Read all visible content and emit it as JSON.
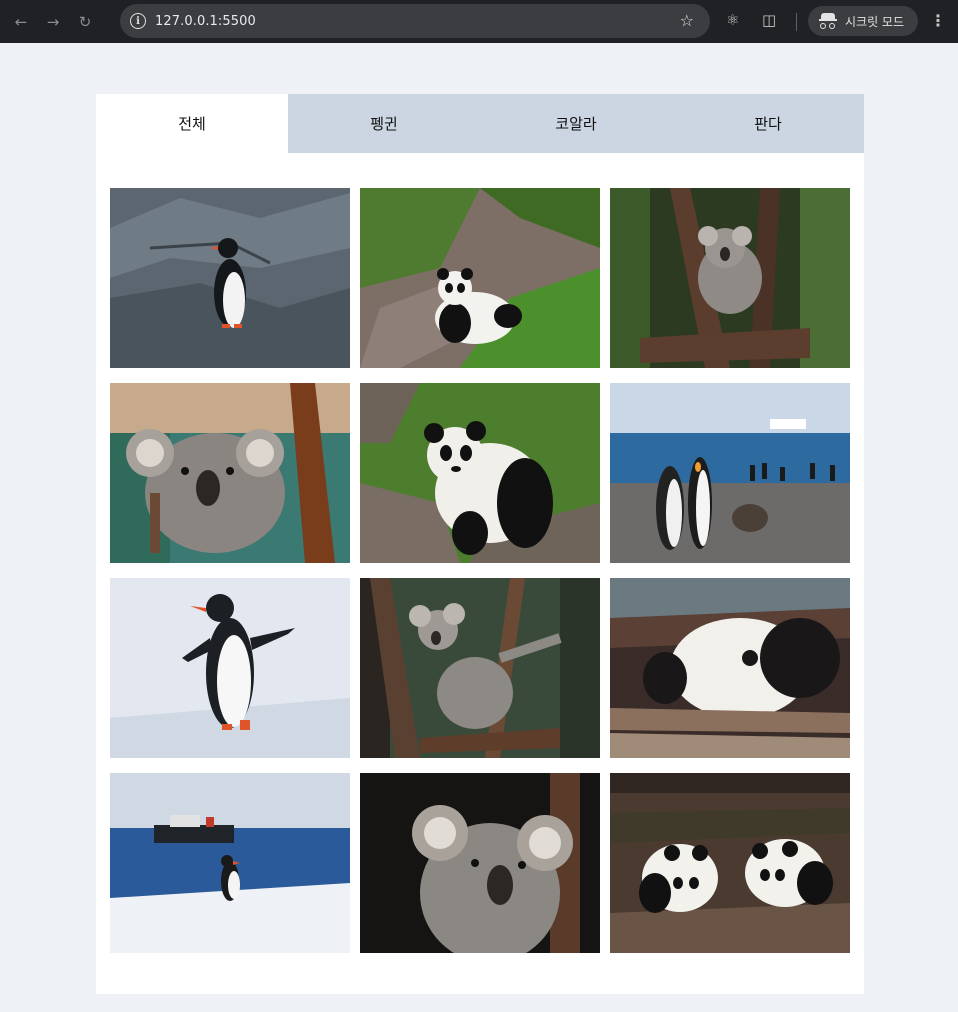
{
  "browser": {
    "url": "127.0.0.1:5500",
    "incognito_label": "시크릿 모드",
    "icons": [
      "back-arrow-icon",
      "forward-arrow-icon",
      "reload-icon",
      "info-icon",
      "star-icon",
      "react-icon",
      "extensions-icon",
      "incognito-icon",
      "menu-icon"
    ]
  },
  "tabs": [
    {
      "label": "전체",
      "active": true
    },
    {
      "label": "펭귄",
      "active": false
    },
    {
      "label": "코알라",
      "active": false
    },
    {
      "label": "판다",
      "active": false
    }
  ],
  "gallery": [
    {
      "animal": "penguin",
      "scene": "rock"
    },
    {
      "animal": "panda",
      "scene": "grass-slope"
    },
    {
      "animal": "koala",
      "scene": "forest"
    },
    {
      "animal": "koala",
      "scene": "closeup-tree"
    },
    {
      "animal": "panda",
      "scene": "grass-standing"
    },
    {
      "animal": "penguin",
      "scene": "beach-colony"
    },
    {
      "animal": "penguin",
      "scene": "snow"
    },
    {
      "animal": "koala",
      "scene": "branches"
    },
    {
      "animal": "panda",
      "scene": "logs"
    },
    {
      "animal": "penguin",
      "scene": "sea-ship"
    },
    {
      "animal": "koala",
      "scene": "portrait-dark"
    },
    {
      "animal": "panda",
      "scene": "two-cubs"
    }
  ],
  "colors": {
    "tab_bg": "#ccd5e2",
    "tab_active_bg": "#ffffff",
    "page_bg": "#eef1f5"
  }
}
